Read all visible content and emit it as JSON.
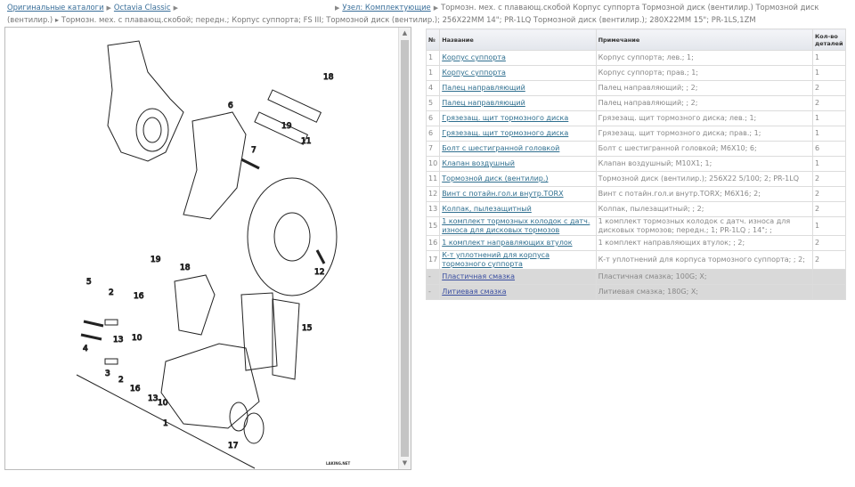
{
  "breadcrumb": {
    "items": [
      {
        "label": "Оригинальные каталоги",
        "link": true
      },
      {
        "label": "Octavia Classic",
        "link": true
      },
      {
        "label": "Узел: Комплектующие",
        "link": true
      }
    ],
    "current": "Тормозн. мех. с плавающ.скобой Корпус суппорта Тормозной диск (вентилир.) Тормозной диск (вентилир.) ▸ Тормозн. мех. с плавающ.скобой; передн.; Корпус суппорта; FS III; Тормозной диск (вентилир.); 256X22MM 14\"; PR-1LQ Тормозной диск (вентилир.); 280X22MM 15\"; PR-1LS,1ZM"
  },
  "diagram": {
    "watermark": "LAKING.NET",
    "callouts": [
      "18",
      "19",
      "6",
      "7",
      "11",
      "12",
      "19",
      "18",
      "5",
      "2",
      "16",
      "15",
      "13",
      "10",
      "4",
      "3",
      "2",
      "16",
      "13",
      "10",
      "1",
      "17"
    ]
  },
  "table": {
    "headers": [
      "№",
      "Название",
      "Примечание",
      "Кол-во деталей"
    ],
    "rows": [
      {
        "no": "1",
        "name": "Корпус суппорта",
        "note": "Корпус суппорта; лев.; 1;",
        "qty": "1"
      },
      {
        "no": "1",
        "name": "Корпус суппорта",
        "note": "Корпус суппорта; прав.; 1;",
        "qty": "1"
      },
      {
        "no": "4",
        "name": "Палец направляющий",
        "note": "Палец направляющий; ; 2;",
        "qty": "2"
      },
      {
        "no": "5",
        "name": "Палец направляющий",
        "note": "Палец направляющий; ; 2;",
        "qty": "2"
      },
      {
        "no": "6",
        "name": "Грязезащ. щит тормозного диска",
        "note": "Грязезащ. щит тормозного диска; лев.; 1;",
        "qty": "1"
      },
      {
        "no": "6",
        "name": "Грязезащ. щит тормозного диска",
        "note": "Грязезащ. щит тормозного диска; прав.; 1;",
        "qty": "1"
      },
      {
        "no": "7",
        "name": "Болт с шестигранной головкой",
        "note": "Болт с шестигранной головкой; M6X10; 6;",
        "qty": "6"
      },
      {
        "no": "10",
        "name": "Клапан воздушный",
        "note": "Клапан воздушный; M10X1; 1;",
        "qty": "1"
      },
      {
        "no": "11",
        "name": "Тормозной диск (вентилир.)",
        "note": "Тормозной диск (вентилир.); 256X22 5/100; 2; PR-1LQ",
        "qty": "2"
      },
      {
        "no": "12",
        "name": "Винт с потайн.гол.и внутр.TORX",
        "note": "Винт с потайн.гол.и внутр.TORX; M6X16; 2;",
        "qty": "2"
      },
      {
        "no": "13",
        "name": "Колпак, пылезащитный",
        "note": "Колпак, пылезащитный; ; 2;",
        "qty": "2"
      },
      {
        "no": "15",
        "name": "1 комплект тормозных колодок с датч. износа для дисковых тормозов",
        "note": "1 комплект тормозных колодок с датч. износа для дисковых тормозов; передн.; 1; PR-1LQ ; 14\"; ;",
        "qty": "1",
        "two": true
      },
      {
        "no": "16",
        "name": "1 комплект направляющих втулок",
        "note": "1 комплект направляющих втулок; ; 2;",
        "qty": "2"
      },
      {
        "no": "17",
        "name": "К-т уплотнений для корпуса тормозного суппорта",
        "note": "К-т уплотнений для корпуса тормозного суппорта; ; 2;",
        "qty": "2",
        "two": true
      },
      {
        "no": "-",
        "name": "Пластичная смазка",
        "note": "Пластичная смазка; 100G; X;",
        "qty": "",
        "grey": true
      },
      {
        "no": "-",
        "name": "Литиевая смазка",
        "note": "Литиевая смазка; 180G; X;",
        "qty": "",
        "grey": true
      }
    ]
  }
}
